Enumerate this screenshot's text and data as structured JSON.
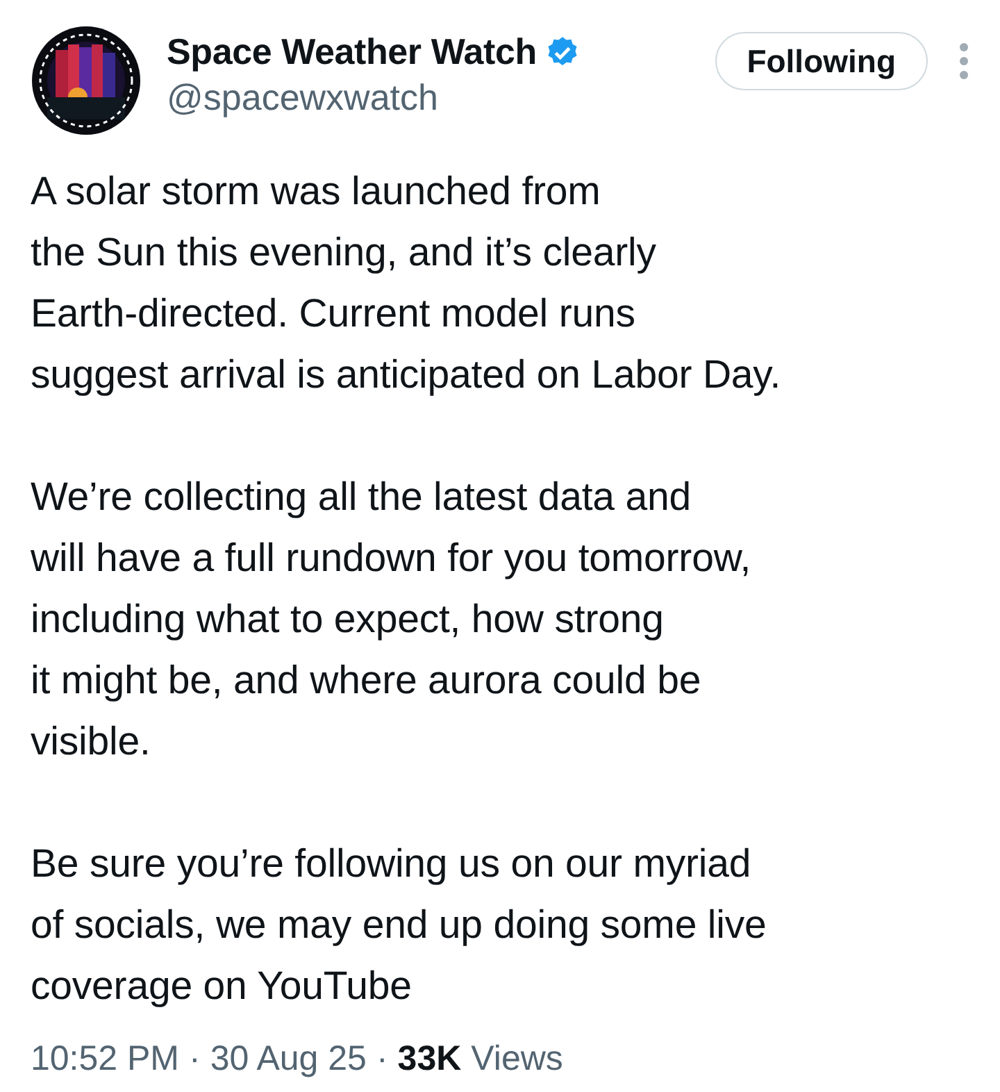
{
  "author": {
    "name": "Space Weather Watch",
    "verified": true,
    "handle": "@spacewxwatch"
  },
  "follow_button": {
    "label": "Following",
    "following": true
  },
  "paragraphs": [
    [
      "A solar storm was launched from",
      "the Sun this evening, and it’s clearly",
      "Earth-directed. Current model runs",
      "suggest arrival is anticipated on Labor Day."
    ],
    [
      "We’re collecting all the latest data and",
      "will have a full rundown for you tomorrow,",
      "including what to expect, how strong",
      "it might be, and where aurora could be",
      "visible."
    ],
    [
      "Be sure you’re following us on our myriad",
      "of socials, we may end up doing some live",
      "coverage on YouTube"
    ]
  ],
  "meta": {
    "time": "10:52 PM",
    "separator_1": "·",
    "date": "30 Aug 25",
    "separator_2": "·",
    "views_count": "33K",
    "views_label": "Views"
  }
}
